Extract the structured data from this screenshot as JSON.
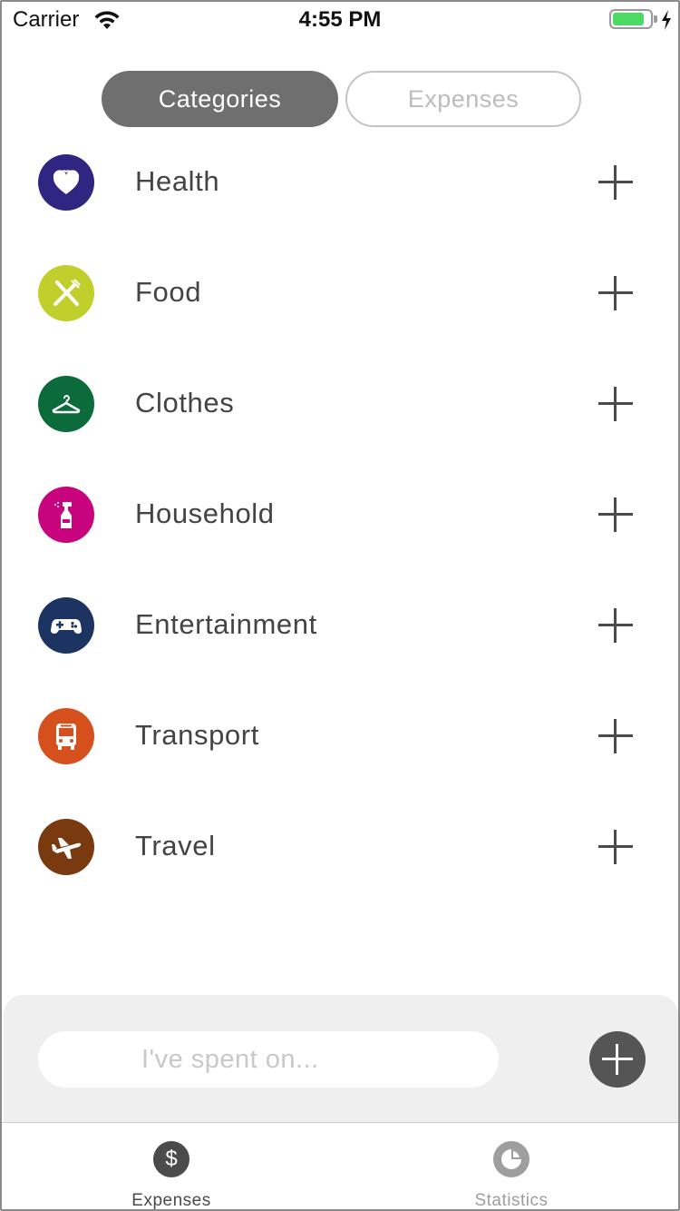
{
  "status_bar": {
    "carrier": "Carrier",
    "time": "4:55 PM",
    "battery_color": "#4cd964"
  },
  "segmented": {
    "active": "Categories",
    "inactive": "Expenses"
  },
  "categories": [
    {
      "label": "Health",
      "icon": "heart-icon",
      "color": "#2e2680"
    },
    {
      "label": "Food",
      "icon": "fork-knife-icon",
      "color": "#c1cf2d"
    },
    {
      "label": "Clothes",
      "icon": "hanger-icon",
      "color": "#0b6b3a"
    },
    {
      "label": "Household",
      "icon": "spray-bottle-icon",
      "color": "#c8037e"
    },
    {
      "label": "Entertainment",
      "icon": "gamepad-icon",
      "color": "#1d3462"
    },
    {
      "label": "Transport",
      "icon": "bus-icon",
      "color": "#d6501e"
    },
    {
      "label": "Travel",
      "icon": "airplane-icon",
      "color": "#7a3a10"
    }
  ],
  "input_bar": {
    "placeholder": "I've spent on...",
    "value": ""
  },
  "tab_bar": {
    "expenses": {
      "label": "Expenses",
      "icon_glyph": "$",
      "icon": "dollar-icon"
    },
    "statistics": {
      "label": "Statistics",
      "icon": "pie-chart-icon"
    }
  }
}
